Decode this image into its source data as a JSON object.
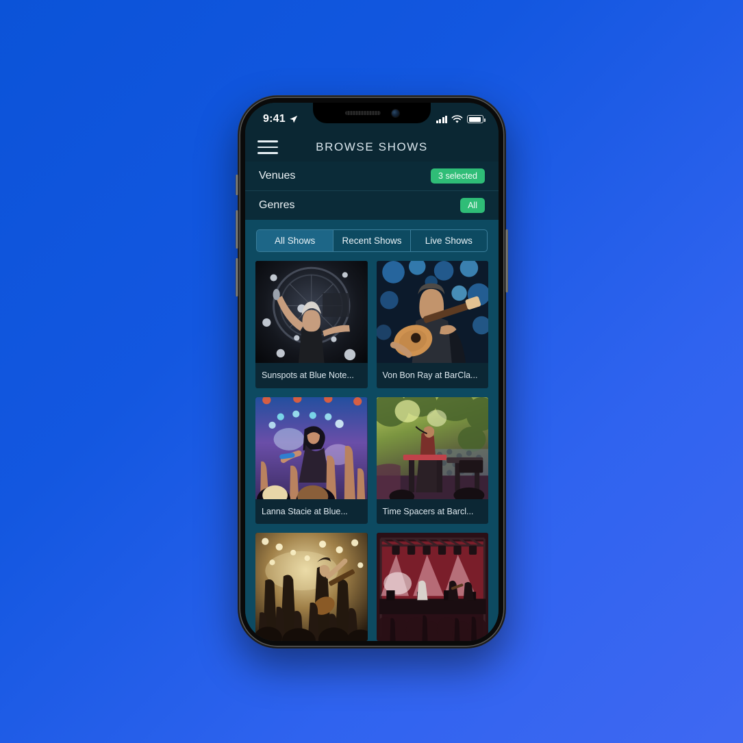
{
  "statusbar": {
    "time": "9:41",
    "location_icon": "location-arrow-icon",
    "signal_icon": "cellular-signal-icon",
    "wifi_icon": "wifi-icon",
    "battery_icon": "battery-icon"
  },
  "navbar": {
    "menu_icon": "hamburger-menu-icon",
    "title": "BROWSE SHOWS"
  },
  "filters": [
    {
      "label": "Venues",
      "badge": "3 selected",
      "badge_color": "#2fbd77"
    },
    {
      "label": "Genres",
      "badge": "All",
      "badge_color": "#2fbd77"
    }
  ],
  "tabs": [
    {
      "label": "All Shows",
      "active": true
    },
    {
      "label": "Recent Shows",
      "active": false
    },
    {
      "label": "Live Shows",
      "active": false
    }
  ],
  "shows": [
    {
      "title": "Sunspots at Blue Note...",
      "image": "singer-arms-raised-dark-stage"
    },
    {
      "title": "Von Bon Ray at BarCla...",
      "image": "acoustic-guitarist-blue-bokeh"
    },
    {
      "title": "Lanna Stacie at Blue...",
      "image": "rock-singer-purple-lights-crowd-hands"
    },
    {
      "title": "Time Spacers at Barcl...",
      "image": "outdoor-daytime-festival-green-trees"
    },
    {
      "title": "",
      "image": "band-on-stage-golden-smoke-crowd"
    },
    {
      "title": "",
      "image": "festival-stage-red-lights-large-crowd"
    }
  ],
  "theme": {
    "page_background": "#1357e0",
    "app_background": "#0b2733",
    "content_background": "#0d4a61",
    "card_background": "#0c2734",
    "accent_green": "#2fbd77",
    "tab_active": "#1d6687"
  }
}
